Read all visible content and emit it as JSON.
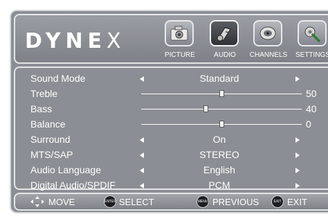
{
  "brand": {
    "logo_text": "DYNE",
    "logo_mark": "X"
  },
  "tabs": [
    {
      "label": "PICTURE",
      "icon": "picture-icon"
    },
    {
      "label": "AUDIO",
      "icon": "audio-icon"
    },
    {
      "label": "CHANNELS",
      "icon": "channels-icon"
    },
    {
      "label": "SETTINGS",
      "icon": "settings-icon"
    }
  ],
  "active_tab": "AUDIO",
  "menu": {
    "items": [
      {
        "label": "Sound Mode",
        "value": "Standard"
      },
      {
        "label": "Treble",
        "level": 50,
        "value": "50"
      },
      {
        "label": "Bass",
        "level": 40,
        "value": "40"
      },
      {
        "label": "Balance",
        "level": 0,
        "value": "0"
      },
      {
        "label": "Surround",
        "value": "On"
      },
      {
        "label": "MTS/SAP",
        "value": "STEREO"
      },
      {
        "label": "Audio Language",
        "value": "English"
      },
      {
        "label": "Digital Audio/SPDIF",
        "value": "PCM"
      }
    ]
  },
  "footer": {
    "move": "MOVE",
    "enter_key": "ENTER",
    "select": "SELECT",
    "menu_key": "MENU",
    "previous": "PREVIOUS",
    "exit_key": "EXIT",
    "exit": "EXIT"
  },
  "colors": {
    "panel": "#8b8e94",
    "border": "#e4e6e8",
    "text": "#ffffff",
    "active_tab": "#303236"
  }
}
